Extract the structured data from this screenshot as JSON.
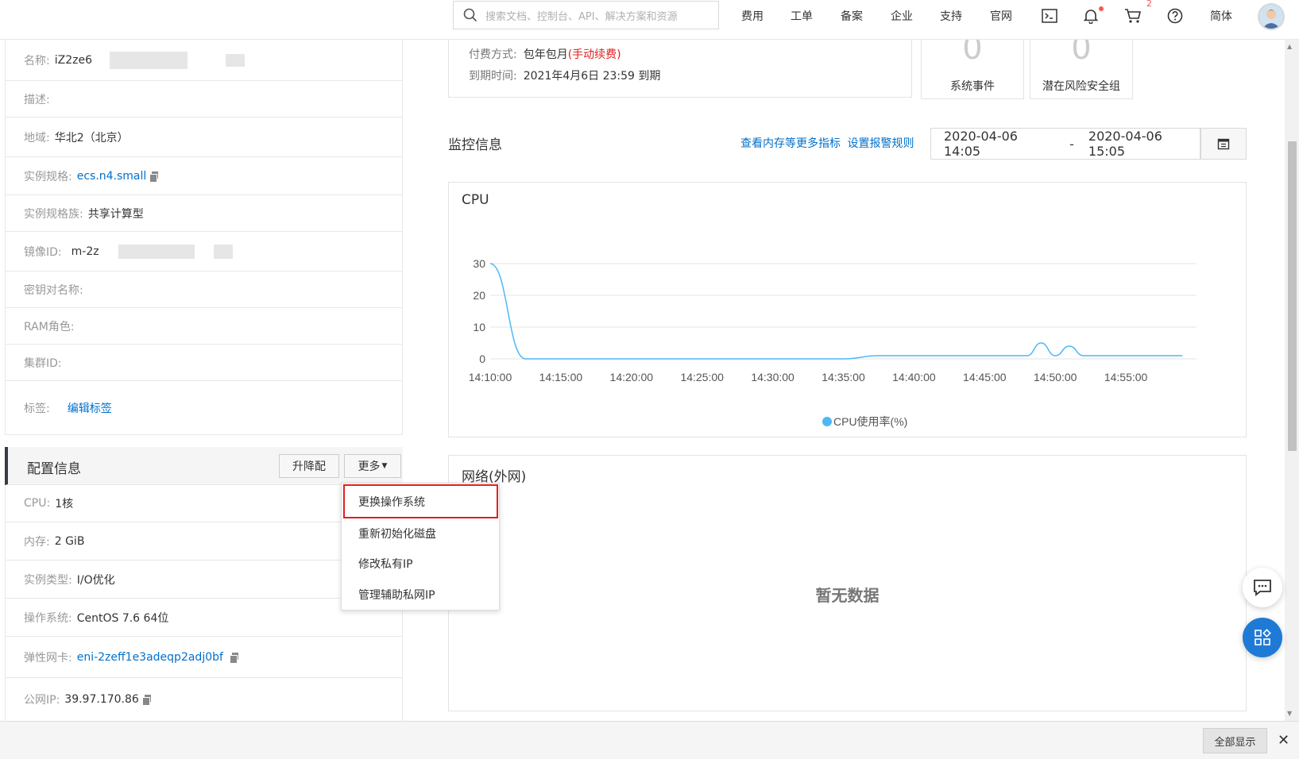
{
  "topbar": {
    "search_placeholder": "搜索文档、控制台、API、解决方案和资源",
    "nav": [
      "费用",
      "工单",
      "备案",
      "企业",
      "支持",
      "官网"
    ],
    "cart_count": "2",
    "lang": "简体",
    "icons": [
      "search-icon",
      "terminal-icon",
      "bell-icon",
      "cart-icon",
      "help-icon"
    ]
  },
  "instance": {
    "name_label": "名称:",
    "name_value": "iZ2ze6",
    "desc_label": "描述:",
    "region_label": "地域:",
    "region_value": "华北2（北京）",
    "spec_label": "实例规格:",
    "spec_value": "ecs.n4.small",
    "family_label": "实例规格族:",
    "family_value": "共享计算型",
    "image_label": "镜像ID:",
    "image_value": "m-2z",
    "keypair_label": "密钥对名称:",
    "ram_label": "RAM角色:",
    "cluster_label": "集群ID:",
    "tags_label": "标签:",
    "tags_link": "编辑标签"
  },
  "config": {
    "title": "配置信息",
    "resize_button": "升降配",
    "more_button": "更多",
    "cpu_label": "CPU:",
    "cpu_value": "1核",
    "mem_label": "内存:",
    "mem_value": "2 GiB",
    "type_label": "实例类型:",
    "type_value": "I/O优化",
    "os_label": "操作系统:",
    "os_value": "CentOS 7.6 64位",
    "eni_label": "弹性网卡:",
    "eni_value": "eni-2zeff1e3adeqp2adj0bf",
    "ip_label": "公网IP:",
    "ip_value": "39.97.170.86"
  },
  "more_menu": {
    "items": [
      "更换操作系统",
      "重新初始化磁盘",
      "修改私有IP",
      "管理辅助私网IP"
    ]
  },
  "billing": {
    "pay_label": "付费方式:",
    "pay_value": "包年包月",
    "pay_note": "(手动续费)",
    "expire_label": "到期时间:",
    "expire_value": "2021年4月6日 23:59 到期"
  },
  "stats": {
    "events_value": "0",
    "events_label": "系统事件",
    "risk_value": "0",
    "risk_label": "潜在风险安全组"
  },
  "monitor": {
    "title": "监控信息",
    "more_link": "查看内存等更多指标",
    "alarm_link": "设置报警规则",
    "start": "2020-04-06 14:05",
    "sep": "-",
    "end": "2020-04-06 15:05"
  },
  "network_card": {
    "title": "网络(外网)",
    "empty": "暂无数据"
  },
  "bottombar": {
    "show_all": "全部显示",
    "close": "✕"
  },
  "chart_data": {
    "type": "line",
    "title": "CPU",
    "x": [
      "14:10:00",
      "14:12:30",
      "14:15:00",
      "14:20:00",
      "14:25:00",
      "14:30:00",
      "14:35:00",
      "14:37:30",
      "14:40:00",
      "14:45:00",
      "14:48:00",
      "14:49:00",
      "14:50:00",
      "14:51:00",
      "14:52:00",
      "14:53:00",
      "14:55:00",
      "14:59:00"
    ],
    "series": [
      {
        "name": "CPU使用率(%)",
        "values": [
          30,
          0,
          0,
          0,
          0,
          0,
          0,
          1,
          1,
          1,
          1,
          5,
          1,
          4,
          1,
          1,
          1,
          1
        ]
      }
    ],
    "xticks": [
      "14:10:00",
      "14:15:00",
      "14:20:00",
      "14:25:00",
      "14:30:00",
      "14:35:00",
      "14:40:00",
      "14:45:00",
      "14:50:00",
      "14:55:00"
    ],
    "yticks": [
      0,
      10,
      20,
      30
    ],
    "ylim": [
      0,
      30
    ],
    "xlabel": "",
    "ylabel": "",
    "grid": true,
    "legend": "bottom",
    "color": "#4db8f5"
  }
}
